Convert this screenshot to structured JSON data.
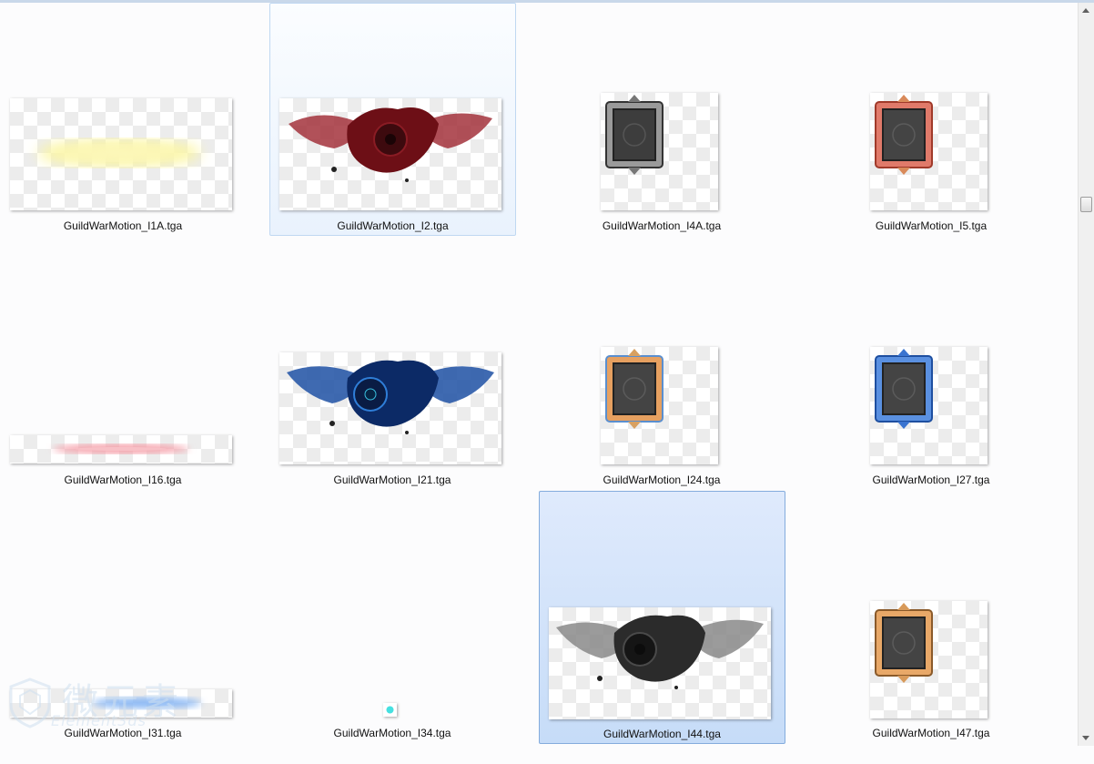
{
  "files": [
    {
      "name": "GuildWarMotion_I1A.tga",
      "art": "yellow-glow"
    },
    {
      "name": "GuildWarMotion_I2.tga",
      "art": "red-winged-emblem"
    },
    {
      "name": "GuildWarMotion_I4A.tga",
      "art": "silver-frame"
    },
    {
      "name": "GuildWarMotion_I5.tga",
      "art": "red-frame"
    },
    {
      "name": "GuildWarMotion_I16.tga",
      "art": "red-glow-strip"
    },
    {
      "name": "GuildWarMotion_I21.tga",
      "art": "blue-winged-emblem"
    },
    {
      "name": "GuildWarMotion_I24.tga",
      "art": "gold-blue-frame"
    },
    {
      "name": "GuildWarMotion_I27.tga",
      "art": "blue-frame"
    },
    {
      "name": "GuildWarMotion_I31.tga",
      "art": "blue-glow-strip"
    },
    {
      "name": "GuildWarMotion_I34.tga",
      "art": "cyan-dot"
    },
    {
      "name": "GuildWarMotion_I44.tga",
      "art": "grey-winged-emblem"
    },
    {
      "name": "GuildWarMotion_I47.tga",
      "art": "gold-frame"
    }
  ],
  "watermark": {
    "text": "微元素",
    "sub": "Element3ds"
  },
  "colors": {
    "selection": "#c6dcf8",
    "hover": "#e9f2fd"
  }
}
